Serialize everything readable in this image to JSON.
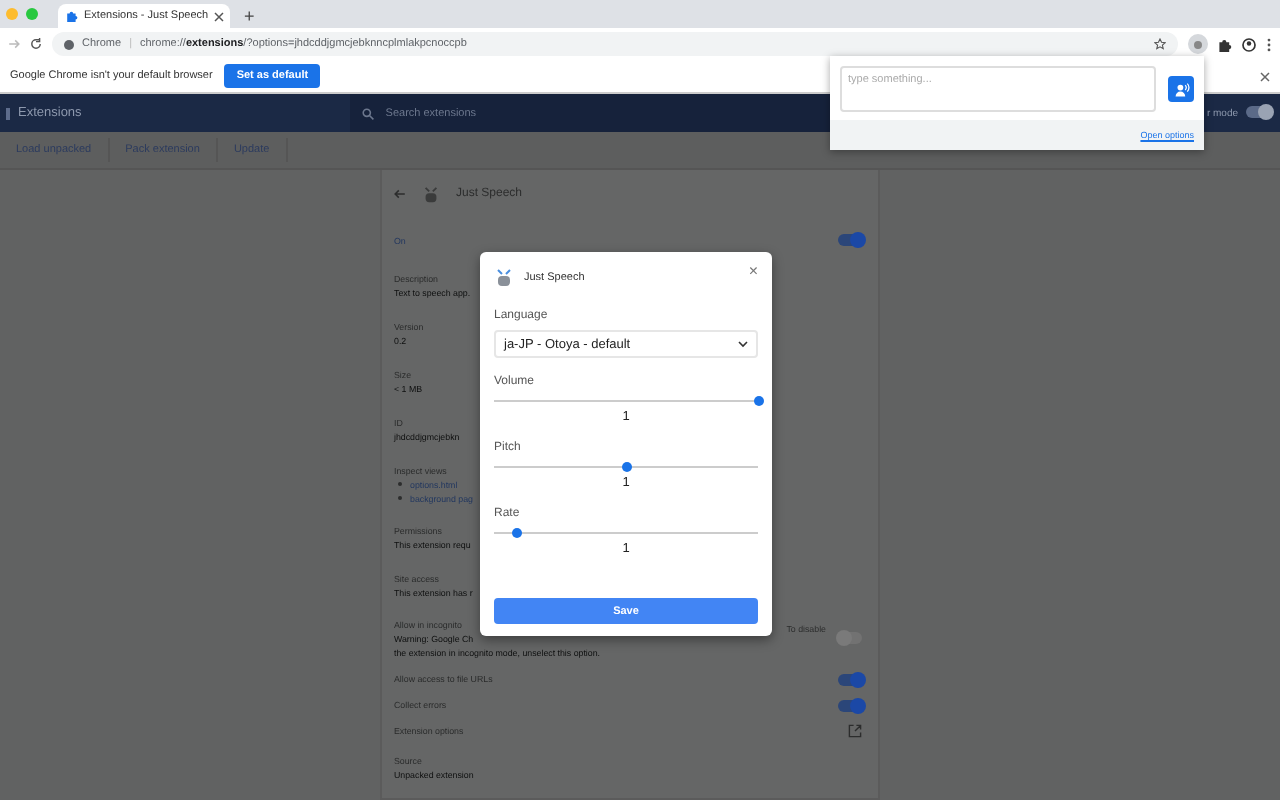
{
  "browser": {
    "tab_title": "Extensions - Just Speech",
    "new_tab": "+",
    "site_label": "Chrome",
    "separator": "|",
    "url": "chrome://**extensions**/?options=jhdcddjgmcjebknncplmlakpcnoccpb"
  },
  "infobar": {
    "message": "Google Chrome isn't your default browser",
    "button": "Set as default"
  },
  "header": {
    "title": "Extensions",
    "search_placeholder": "Search extensions",
    "developer_mode": {
      "label": "r mode",
      "on": true
    }
  },
  "toolbar": [
    "Load unpacked",
    "Pack extension",
    "Update"
  ],
  "details": {
    "name": "Just Speech",
    "state_label": "On",
    "enabled": true,
    "sections": [
      {
        "kind": "info",
        "label": "Description",
        "lines": [
          "Text to speech app."
        ]
      },
      {
        "kind": "info",
        "label": "Version",
        "lines": [
          "0.2"
        ]
      },
      {
        "kind": "info",
        "label": "Size",
        "lines": [
          "< 1 MB"
        ]
      },
      {
        "kind": "info",
        "label": "ID",
        "lines": [
          "jhdcddjgmcjebkn"
        ]
      },
      {
        "kind": "links",
        "label": "Inspect views",
        "links": [
          "options.html",
          "background pag"
        ]
      },
      {
        "kind": "info",
        "label": "Permissions",
        "lines": [
          "This extension requ"
        ]
      },
      {
        "kind": "info",
        "label": "Site access",
        "lines": [
          "This extension has r"
        ]
      },
      {
        "kind": "toggle",
        "label": "Allow in incognito",
        "lines": [
          "Warning: Google Ch",
          "the extension in incognito mode, unselect this option."
        ],
        "note": "To disable",
        "on": false
      },
      {
        "kind": "toggle",
        "label": "Allow access to file URLs",
        "on": true
      },
      {
        "kind": "toggle",
        "label": "Collect errors",
        "on": true
      },
      {
        "kind": "action",
        "label": "Extension options"
      },
      {
        "kind": "info",
        "label": "Source",
        "lines": [
          "Unpacked extension"
        ]
      }
    ]
  },
  "dialog": {
    "title": "Just Speech",
    "close": "×",
    "language": {
      "label": "Language",
      "value": "ja-JP - Otoya - default"
    },
    "sliders": [
      {
        "label": "Volume",
        "level": 1.0,
        "reading": "1"
      },
      {
        "label": "Pitch",
        "level": 0.5,
        "reading": "1"
      },
      {
        "label": "Rate",
        "level": 0.09,
        "reading": "1"
      }
    ],
    "button": "Save"
  },
  "popup": {
    "placeholder": "type something...",
    "link": "Open options"
  }
}
